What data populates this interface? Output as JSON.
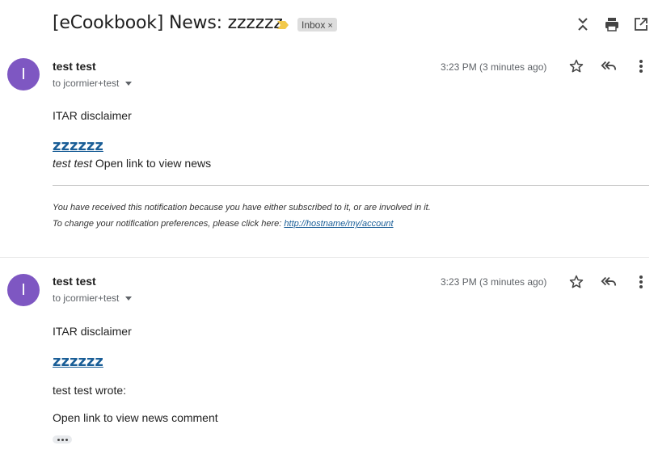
{
  "thread": {
    "subject": "[eCookbook] News: zzzzzz",
    "label": "Inbox",
    "label_remove": "×"
  },
  "messages": [
    {
      "avatar_letter": "I",
      "sender": "test test",
      "to": "to jcormier+test",
      "timestamp": "3:23 PM (3 minutes ago)",
      "disclaimer": "ITAR disclaimer",
      "news_title": "zzzzzz",
      "author": "test test",
      "open_link_text": "Open link to view news",
      "footer_line1": "You have received this notification because you have either subscribed to it, or are involved in it.",
      "footer_line2_prefix": "To change your notification preferences, please click here:",
      "footer_link": "http://hostname/my/account"
    },
    {
      "avatar_letter": "I",
      "sender": "test test",
      "to": "to jcormier+test",
      "timestamp": "3:23 PM (3 minutes ago)",
      "disclaimer": "ITAR disclaimer",
      "news_title": "zzzzzz",
      "wrote_line": "test test wrote:",
      "open_link_text": "Open link to view news comment"
    }
  ],
  "colors": {
    "avatar": "#7e57c2",
    "link": "#1a5e97",
    "importance": "#f2c94c"
  },
  "icons": [
    "collapse-all-icon",
    "print-icon",
    "open-in-new-window-icon",
    "star-icon",
    "reply-all-icon",
    "more-vert-icon",
    "importance-marker-icon",
    "show-trimmed-content-icon"
  ]
}
